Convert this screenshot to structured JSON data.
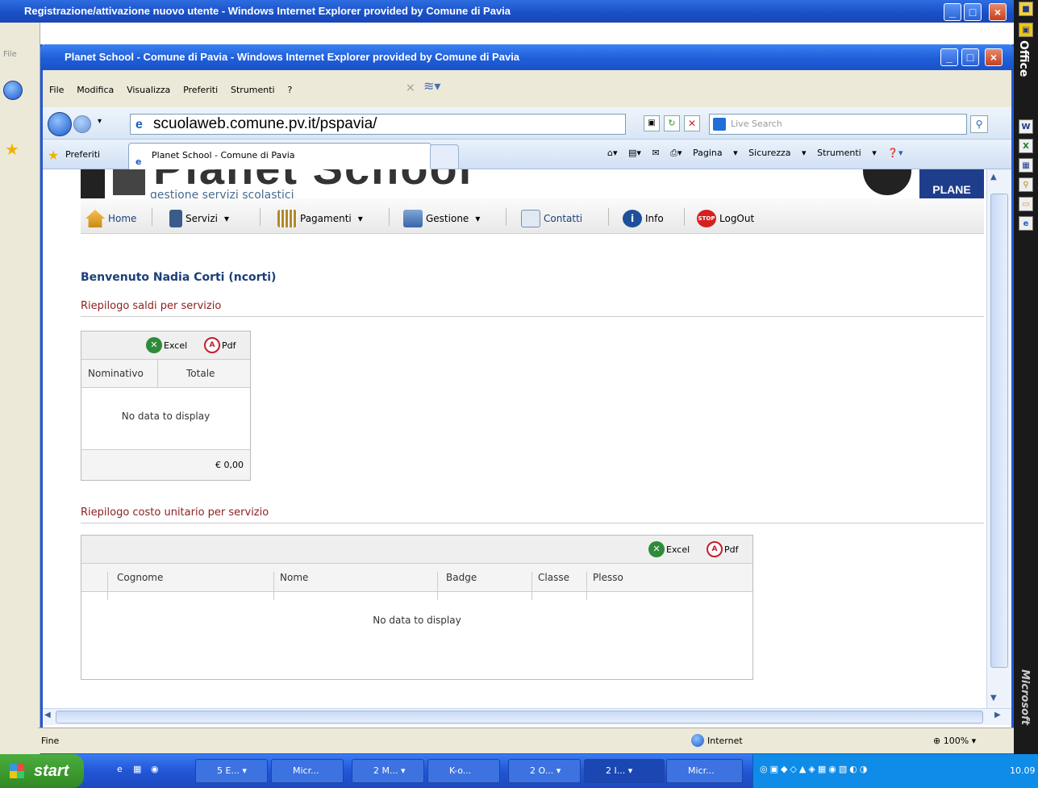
{
  "bg_window": {
    "title": "Registrazione/attivazione nuovo utente - Windows Internet Explorer provided by Comune di Pavia",
    "left_label": "File"
  },
  "window": {
    "title": "Planet School - Comune di Pavia - Windows Internet Explorer provided by Comune di Pavia"
  },
  "menu": {
    "items": [
      "File",
      "Modifica",
      "Visualizza",
      "Preferiti",
      "Strumenti",
      "?"
    ]
  },
  "address": {
    "url": "scuolaweb.comune.pv.it/pspavia/",
    "search_placeholder": "Live Search"
  },
  "tabs": {
    "favorites": "Preferiti",
    "active_tab": "Planet School - Comune di Pavia"
  },
  "toolbar": {
    "page": "Pagina",
    "security": "Sicurezza",
    "tools": "Strumenti"
  },
  "banner": {
    "title": "Planet School",
    "subtitle": "gestione servizi scolastici",
    "logo": "PLANE"
  },
  "nav": {
    "home": "Home",
    "services": "Servizi",
    "payments": "Pagamenti",
    "management": "Gestione",
    "contacts": "Contatti",
    "info": "Info",
    "logout": "LogOut"
  },
  "welcome": "Benvenuto Nadia Corti (ncorti)",
  "section1": {
    "title": "Riepilogo saldi per servizio",
    "excel": "Excel",
    "pdf": "Pdf",
    "columns": [
      "Nominativo",
      "Totale"
    ],
    "empty": "No data to display",
    "total": "€ 0,00"
  },
  "section2": {
    "title": "Riepilogo costo unitario per servizio",
    "excel": "Excel",
    "pdf": "Pdf",
    "columns": [
      "Cognome",
      "Nome",
      "Badge",
      "Classe",
      "Plesso"
    ],
    "empty": "No data to display"
  },
  "status": {
    "left": "Fine",
    "zone": "Internet",
    "zoom": "100%"
  },
  "taskbar": {
    "start": "start",
    "tasks": [
      "5 E...",
      "Micr...",
      "2 M...",
      "K-o...",
      "2 O...",
      "2 I...",
      "Micr..."
    ],
    "clock": "10.09"
  },
  "office_bar": {
    "label": "Office",
    "brand": "Microsoft"
  }
}
